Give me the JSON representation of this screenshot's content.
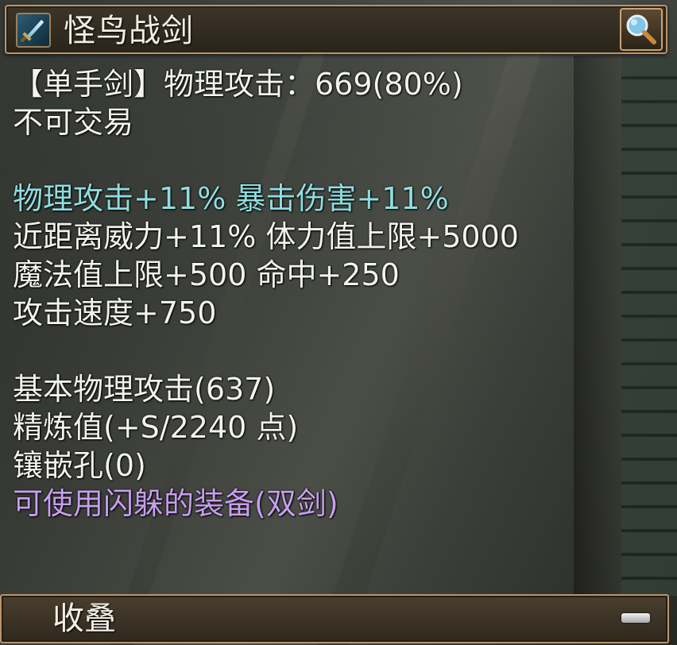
{
  "item": {
    "name": "怪鸟战剑",
    "icon": "sword-icon"
  },
  "header": {
    "inspect_icon": "magnifier-icon"
  },
  "stats": [
    {
      "text": "【单手剑】物理攻击：669(80%)",
      "color": "white"
    },
    {
      "text": "不可交易",
      "color": "white"
    },
    {
      "text": "",
      "color": "white"
    },
    {
      "text": "物理攻击+11% 暴击伤害+11%",
      "color": "cyan"
    },
    {
      "text": "近距离威力+11% 体力值上限+5000",
      "color": "white"
    },
    {
      "text": "魔法值上限+500 命中+250",
      "color": "white"
    },
    {
      "text": "攻击速度+750",
      "color": "white"
    },
    {
      "text": "",
      "color": "white"
    },
    {
      "text": "基本物理攻击(637)",
      "color": "white"
    },
    {
      "text": "精炼值(+S/2240 点)",
      "color": "white"
    },
    {
      "text": "镶嵌孔(0)",
      "color": "white"
    },
    {
      "text": "可使用闪躲的装备(双剑)",
      "color": "purple"
    }
  ],
  "footer": {
    "label": "收叠",
    "icon": "minus-icon"
  },
  "colors": {
    "white": "#f2f2ee",
    "cyan": "#8fdde0",
    "purple": "#c79ef0",
    "frame": "#b8956a"
  }
}
